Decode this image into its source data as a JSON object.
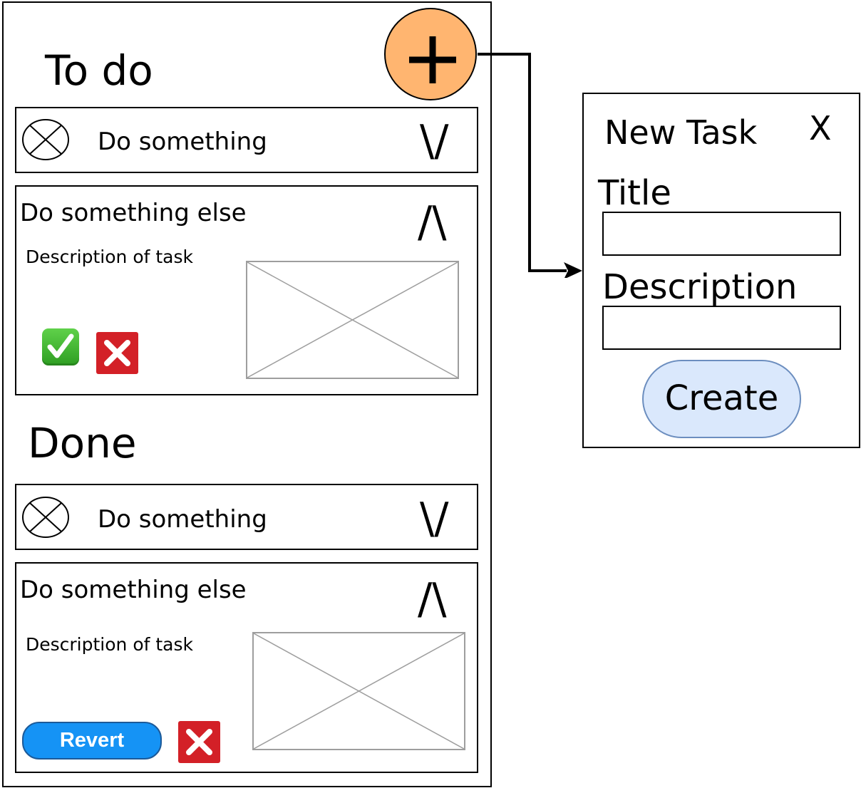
{
  "todo": {
    "title": "To do",
    "add_icon": "plus-icon",
    "collapsed_task": {
      "label": "Do something",
      "status_icon": "x-circle-icon",
      "expand_glyph": "\\/"
    },
    "expanded_task": {
      "label": "Do something else",
      "collapse_glyph": "/\\",
      "description": "Description of task",
      "image_icon": "image-placeholder-icon",
      "complete_icon": "check-icon",
      "delete_icon": "x-icon"
    }
  },
  "done": {
    "title": "Done",
    "collapsed_task": {
      "label": "Do something",
      "status_icon": "x-circle-icon",
      "expand_glyph": "\\/"
    },
    "expanded_task": {
      "label": "Do something else",
      "collapse_glyph": "/\\",
      "description": "Description of task",
      "image_icon": "image-placeholder-icon",
      "revert_label": "Revert",
      "delete_icon": "x-icon"
    }
  },
  "new_task_dialog": {
    "title": "New Task",
    "close_label": "X",
    "title_field_label": "Title",
    "title_value": "",
    "description_field_label": "Description",
    "description_value": "",
    "create_label": "Create"
  },
  "colors": {
    "fab": "#FFB570",
    "create_button": "#dae8fc",
    "create_border": "#6c8ebf",
    "revert_button": "#1593f5",
    "delete_button": "#D32027",
    "complete_button": "#3cb82c"
  }
}
